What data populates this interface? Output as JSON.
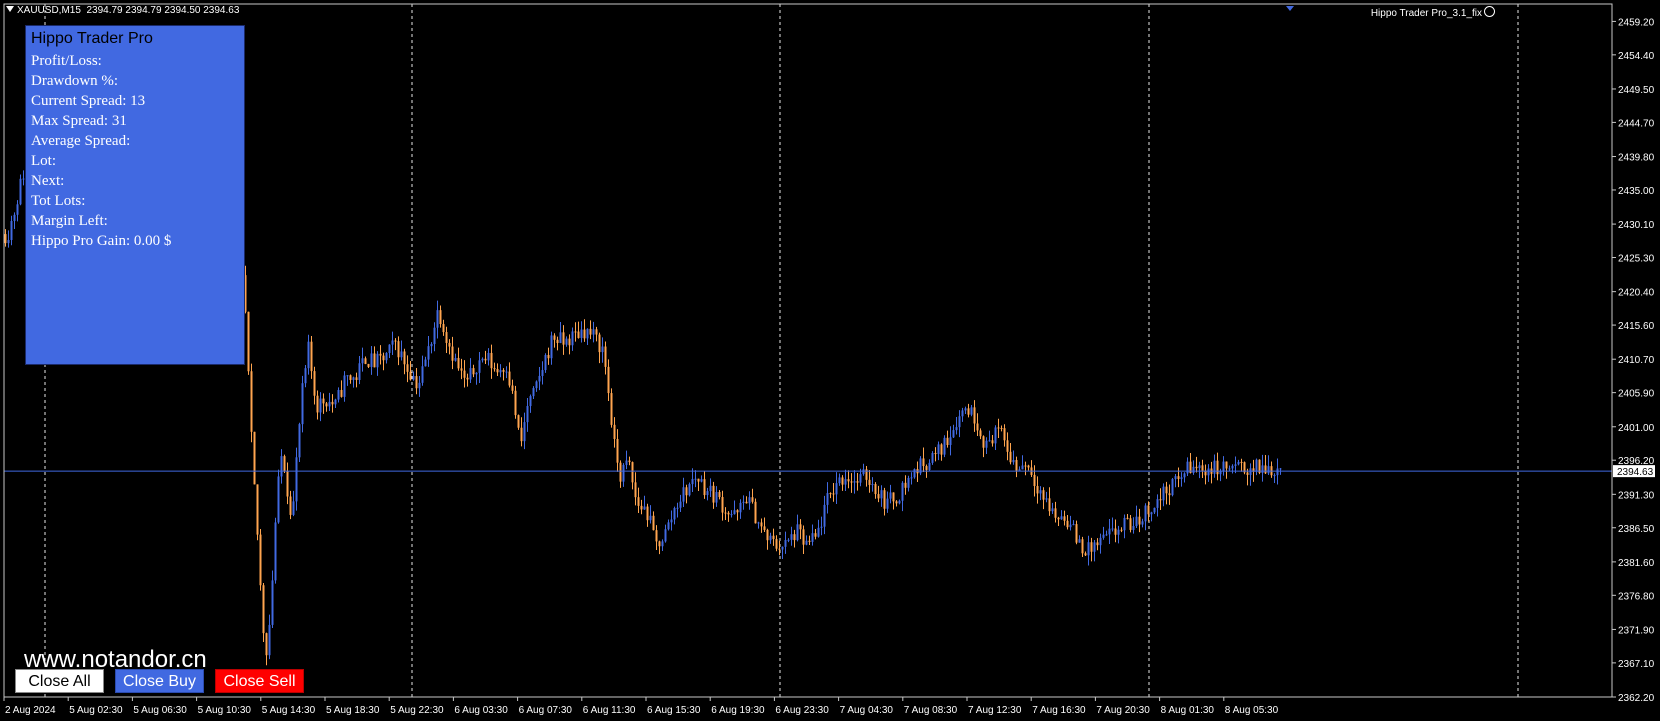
{
  "header": {
    "symbol": "XAUUSD,M15",
    "ohlc": "2394.79 2394.79 2394.50 2394.63",
    "ea_name": "Hippo Trader Pro_3.1_fix"
  },
  "panel": {
    "title": "Hippo Trader Pro",
    "lines": [
      "Profit/Loss:",
      "Drawdown %:",
      "Current Spread: 13",
      "Max Spread: 31",
      "Average Spread:",
      "Lot:",
      "Next:",
      "Tot Lots:",
      "Margin Left:",
      "Hippo Pro Gain: 0.00 $"
    ],
    "background_color": "#4169e1"
  },
  "watermark": "www.notandor.cn",
  "buttons": {
    "close_all": "Close All",
    "close_buy": "Close Buy",
    "close_sell": "Close Sell"
  },
  "colors": {
    "background": "#000000",
    "bull_candle": "#4169e1",
    "bear_candle": "#ffa54f",
    "bid_line": "#4169e1",
    "grid": "#ffffff"
  },
  "chart_data": {
    "type": "candlestick",
    "ylim": [
      2362.2,
      2461.7
    ],
    "price_ticks": [
      "2459.20",
      "2454.40",
      "2449.50",
      "2444.70",
      "2439.80",
      "2435.00",
      "2430.10",
      "2425.30",
      "2420.40",
      "2415.60",
      "2410.70",
      "2405.90",
      "2401.00",
      "2396.20",
      "2391.30",
      "2386.50",
      "2381.60",
      "2376.80",
      "2371.90",
      "2367.10",
      "2362.20"
    ],
    "current_price": "2394.63",
    "time_ticks": [
      "2 Aug 2024",
      "5 Aug 02:30",
      "5 Aug 06:30",
      "5 Aug 10:30",
      "5 Aug 14:30",
      "5 Aug 18:30",
      "5 Aug 22:30",
      "6 Aug 03:30",
      "6 Aug 07:30",
      "6 Aug 11:30",
      "6 Aug 15:30",
      "6 Aug 19:30",
      "6 Aug 23:30",
      "7 Aug 04:30",
      "7 Aug 08:30",
      "7 Aug 12:30",
      "7 Aug 16:30",
      "7 Aug 20:30",
      "8 Aug 01:30",
      "8 Aug 05:30"
    ],
    "price_path": [
      [
        0,
        2432
      ],
      [
        6,
        2428
      ],
      [
        14,
        2432
      ],
      [
        22,
        2437
      ],
      [
        30,
        2440
      ],
      [
        40,
        2442
      ],
      [
        60,
        2444
      ],
      [
        80,
        2446
      ],
      [
        120,
        2446
      ],
      [
        160,
        2446
      ],
      [
        200,
        2444
      ],
      [
        230,
        2432
      ],
      [
        244,
        2420
      ],
      [
        248,
        2408
      ],
      [
        252,
        2396
      ],
      [
        256,
        2388
      ],
      [
        260,
        2378
      ],
      [
        265,
        2368
      ],
      [
        270,
        2374
      ],
      [
        276,
        2390
      ],
      [
        282,
        2398
      ],
      [
        287,
        2392
      ],
      [
        292,
        2388
      ],
      [
        297,
        2398
      ],
      [
        302,
        2406
      ],
      [
        308,
        2412
      ],
      [
        316,
        2404
      ],
      [
        325,
        2405
      ],
      [
        335,
        2404
      ],
      [
        345,
        2408
      ],
      [
        355,
        2408
      ],
      [
        365,
        2411
      ],
      [
        375,
        2410
      ],
      [
        385,
        2411
      ],
      [
        395,
        2413
      ],
      [
        405,
        2410
      ],
      [
        418,
        2407
      ],
      [
        428,
        2412
      ],
      [
        438,
        2418
      ],
      [
        446,
        2414
      ],
      [
        456,
        2410
      ],
      [
        466,
        2407
      ],
      [
        476,
        2410
      ],
      [
        486,
        2411
      ],
      [
        496,
        2409
      ],
      [
        506,
        2410
      ],
      [
        514,
        2404
      ],
      [
        520,
        2398
      ],
      [
        527,
        2404
      ],
      [
        535,
        2406
      ],
      [
        543,
        2410
      ],
      [
        553,
        2414
      ],
      [
        563,
        2413
      ],
      [
        573,
        2414
      ],
      [
        583,
        2415
      ],
      [
        593,
        2414
      ],
      [
        603,
        2412
      ],
      [
        608,
        2406
      ],
      [
        614,
        2398
      ],
      [
        620,
        2394
      ],
      [
        628,
        2396
      ],
      [
        636,
        2390
      ],
      [
        646,
        2389
      ],
      [
        656,
        2384
      ],
      [
        666,
        2386
      ],
      [
        676,
        2390
      ],
      [
        686,
        2392
      ],
      [
        696,
        2394
      ],
      [
        706,
        2392
      ],
      [
        716,
        2391
      ],
      [
        726,
        2389
      ],
      [
        736,
        2388
      ],
      [
        746,
        2391
      ],
      [
        756,
        2388
      ],
      [
        766,
        2385
      ],
      [
        776,
        2384
      ],
      [
        786,
        2384
      ],
      [
        796,
        2386
      ],
      [
        806,
        2384
      ],
      [
        816,
        2385
      ],
      [
        826,
        2390
      ],
      [
        836,
        2393
      ],
      [
        846,
        2394
      ],
      [
        856,
        2393
      ],
      [
        866,
        2394
      ],
      [
        876,
        2392
      ],
      [
        886,
        2390
      ],
      [
        896,
        2391
      ],
      [
        906,
        2393
      ],
      [
        916,
        2395
      ],
      [
        926,
        2396
      ],
      [
        936,
        2397
      ],
      [
        946,
        2399
      ],
      [
        956,
        2402
      ],
      [
        966,
        2404
      ],
      [
        976,
        2402
      ],
      [
        986,
        2398
      ],
      [
        996,
        2401
      ],
      [
        1006,
        2398
      ],
      [
        1016,
        2395
      ],
      [
        1026,
        2396
      ],
      [
        1036,
        2393
      ],
      [
        1046,
        2390
      ],
      [
        1056,
        2388
      ],
      [
        1066,
        2388
      ],
      [
        1076,
        2385
      ],
      [
        1086,
        2383
      ],
      [
        1096,
        2384
      ],
      [
        1106,
        2385
      ],
      [
        1116,
        2386
      ],
      [
        1126,
        2387
      ],
      [
        1136,
        2387
      ],
      [
        1146,
        2389
      ],
      [
        1156,
        2390
      ],
      [
        1166,
        2392
      ],
      [
        1176,
        2393
      ],
      [
        1186,
        2395
      ],
      [
        1196,
        2395
      ],
      [
        1206,
        2395
      ],
      [
        1214,
        2395
      ]
    ]
  }
}
